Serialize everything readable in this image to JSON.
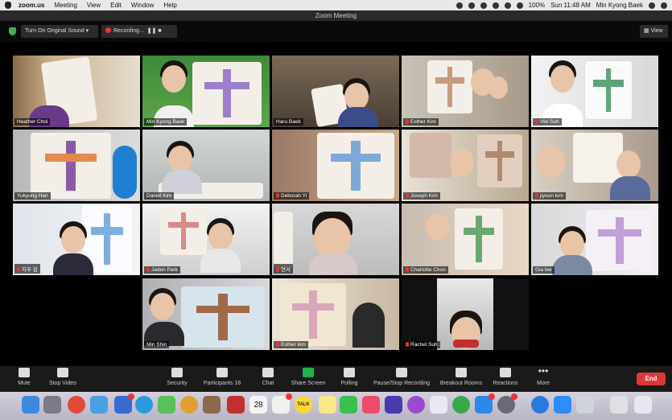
{
  "menubar": {
    "app": "zoom.us",
    "items": [
      "Meeting",
      "View",
      "Edit",
      "Window",
      "Help"
    ],
    "battery": "100%",
    "datetime": "Sun 11:48 AM",
    "user": "Min Kyong Baek"
  },
  "window": {
    "title": "Zoom Meeting"
  },
  "toolbar": {
    "sound_label": "Turn On Original Sound",
    "recording_label": "Recording...",
    "view_label": "View"
  },
  "participants": [
    {
      "name": "Heather Choi",
      "muted": false
    },
    {
      "name": "Min Kyong Baek",
      "muted": false
    },
    {
      "name": "Haru Baek",
      "muted": false
    },
    {
      "name": "Esther Kim",
      "muted": true
    },
    {
      "name": "Vivi Suh",
      "muted": true
    },
    {
      "name": "Yukyung Han",
      "muted": false,
      "active": true
    },
    {
      "name": "Daniel Kim",
      "muted": false
    },
    {
      "name": "Deborah Yi",
      "muted": true
    },
    {
      "name": "Joseph Kim",
      "muted": true
    },
    {
      "name": "jiyoun kim",
      "muted": true
    },
    {
      "name": "지우 김",
      "muted": true
    },
    {
      "name": "Jaden Park",
      "muted": true
    },
    {
      "name": "연서",
      "muted": true
    },
    {
      "name": "Charlotte Choo",
      "muted": true
    },
    {
      "name": "Gia lee",
      "muted": false
    },
    {
      "name": "Min Shin",
      "muted": false
    },
    {
      "name": "Esther kim",
      "muted": true
    },
    {
      "name": "Rachel Suh",
      "muted": true
    }
  ],
  "controls": {
    "mute": "Mute",
    "stop_video": "Stop Video",
    "security": "Security",
    "participants": "Participants",
    "participants_count": "18",
    "chat": "Chat",
    "share_screen": "Share Screen",
    "polling": "Polling",
    "recording": "Pause/Stop Recording",
    "breakout": "Breakout Rooms",
    "reactions": "Reactions",
    "more": "More",
    "end": "End"
  },
  "dock": {
    "calendar_day": "28",
    "talk_label": "TALK"
  },
  "colors": {
    "end_button": "#e03838",
    "share_green": "#22b14c",
    "active_speaker": "#d8d84a",
    "muted_red": "#e33333"
  }
}
